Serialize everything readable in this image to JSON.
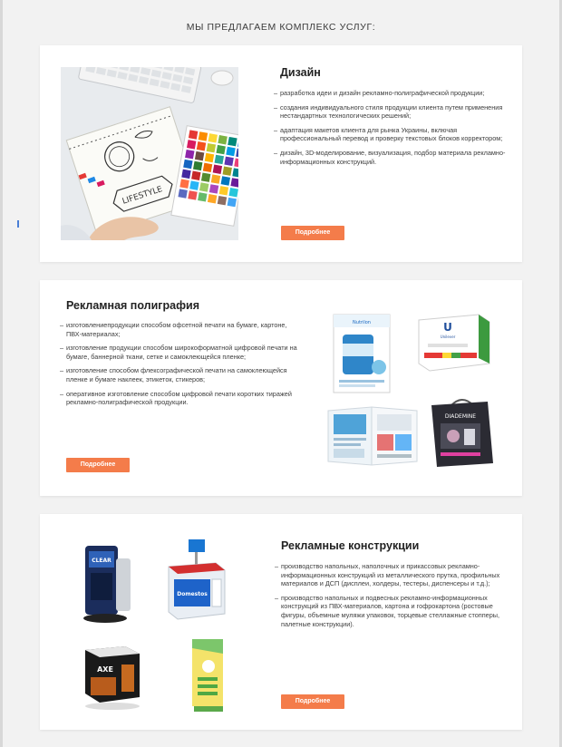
{
  "heading": "МЫ ПРЕДЛАГАЕМ КОМПЛЕКС УСЛУГ:",
  "sections": [
    {
      "title": "Дизайн",
      "items": [
        "разработка идеи и дизайн рекламно-полиграфической продукции;",
        "создания индивидуального стиля продукции клиента путем применения нестандартных технологических решений;",
        "адаптация макетов клиента для рынка Украины, включая профессиональный перевод и проверку текстовых блоков корректором;",
        "дизайн, 3D-моделирование, визуализация, подбор материала рекламно-информационных конструкций."
      ],
      "button": "Подробнее"
    },
    {
      "title": "Рекламная полиграфия",
      "items": [
        "изготовлениепродукции способом офсетной печати на бумаге, картоне, ПВХ-материалах;",
        "изготовление продукции способом широкоформатной цифровой печати на бумаге, баннерной ткани, сетке и самоклеющейся пленке;",
        "изготовление способом флексографической печати на самоклеющейся пленке и бумаге наклеек, этикеток, стикеров;",
        "оперативное изготовление способом цифровой печати коротких тиражей рекламно-полиграфической продукции."
      ],
      "button": "Подробнее"
    },
    {
      "title": "Рекламные конструкции",
      "items": [
        "производство напольных, наполочных и прикассовых рекламно-информационных конструкций из металлического прутка, профильных материалов и ДСП (дисплеи, холдеры, тестеры, диспенсеры и т.д.);",
        "производство напольных и подвесных рекламно-информационных конструкций из ПВХ-материалов, картона и гофрокартона (ростовые фигуры, объемные муляжи упаковок, торцевые стеллажные стопперы, палетные конструкции)."
      ],
      "button": "Подробнее"
    }
  ],
  "colors": {
    "accent": "#f47c4a",
    "background": "#f2f2f2",
    "card": "#ffffff"
  },
  "image_content": {
    "design_photo_text": "LIFESTYLE",
    "product_texts": [
      "Nutrilon",
      "Unilever",
      "DIADEMINE",
      "CLEAR",
      "AXE",
      "Domestos"
    ]
  }
}
